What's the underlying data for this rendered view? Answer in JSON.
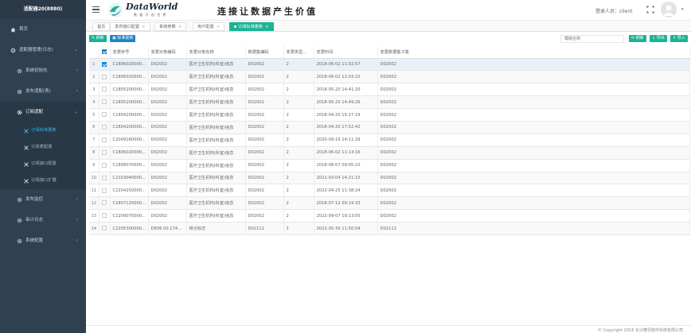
{
  "sidebar": {
    "title": "适配器20(8880)",
    "items": [
      {
        "label": "首页",
        "icon": "home-icon"
      },
      {
        "label": "适配器管理(日志)",
        "icon": "settings-icon",
        "expandable": true
      },
      {
        "label": "系统初始化",
        "icon": "gear-icon",
        "expandable": true
      },
      {
        "label": "发布适配(表)",
        "icon": "gear-icon",
        "expandable": true
      },
      {
        "label": "订阅适配",
        "icon": "gear-icon",
        "expandable": true
      },
      {
        "label": "发布监控",
        "icon": "gear-icon",
        "expandable": true
      },
      {
        "label": "审计日志",
        "icon": "gear-icon",
        "expandable": true
      },
      {
        "label": "系统配置",
        "icon": "gear-icon",
        "expandable": true
      }
    ],
    "subitems": [
      {
        "label": "订阅标准更新",
        "selected": true
      },
      {
        "label": "订阅表配置"
      },
      {
        "label": "订阅接口配置"
      },
      {
        "label": "订阅接口扩展"
      }
    ]
  },
  "header": {
    "brand": "DataWorld",
    "brand_sub": "数 据 开 创 世 界",
    "slogan": "连接让数据产生价值",
    "user_label": "登录人员：client"
  },
  "tabs": [
    {
      "label": "首页",
      "closable": false
    },
    {
      "label": "发布接口配置",
      "closable": true
    },
    {
      "label": "系统参数",
      "closable": true
    },
    {
      "label": "用户配置",
      "closable": true
    },
    {
      "label": "订阅标准更新",
      "closable": true,
      "active": true
    }
  ],
  "toolbar": {
    "left_buttons": [
      "刷新",
      "标准更新"
    ],
    "search_placeholder": "模版名称",
    "right_buttons": [
      "刷新",
      "导出",
      "导入"
    ]
  },
  "table": {
    "columns": [
      "",
      "",
      "变更序号",
      "变更对象编码",
      "变更对象名称",
      "数据集编码",
      "变更类型...",
      "变更时间",
      "变更数据集子集"
    ],
    "rows": [
      {
        "n": "1",
        "checked": true,
        "c1": "C1806020000...",
        "c2": "D02002",
        "c3": "医疗卫生机构(科室)信息",
        "c4": "D02002",
        "c5": "2",
        "c6": "2018-06-02 11:02:57",
        "c7": "D02002"
      },
      {
        "n": "2",
        "checked": false,
        "c1": "C1806020000...",
        "c2": "D02002",
        "c3": "医疗卫生机构(科室)信息",
        "c4": "D02002",
        "c5": "2",
        "c6": "2018-06-02 11:03:22",
        "c7": "D02002"
      },
      {
        "n": "3",
        "checked": false,
        "c1": "C1805200000...",
        "c2": "D02002",
        "c3": "医疗卫生机构(科室)信息",
        "c4": "D02002",
        "c5": "2",
        "c6": "2018-05-20 14:41:20",
        "c7": "D02002"
      },
      {
        "n": "4",
        "checked": false,
        "c1": "C1805200000...",
        "c2": "D02002",
        "c3": "医疗卫生机构(科室)信息",
        "c4": "D02002",
        "c5": "2",
        "c6": "2018-05-20 14:49:26",
        "c7": "D02002"
      },
      {
        "n": "5",
        "checked": false,
        "c1": "C1804200000...",
        "c2": "D02002",
        "c3": "医疗卫生机构(科室)信息",
        "c4": "D02002",
        "c5": "2",
        "c6": "2018-04-20 15:27:19",
        "c7": "D02002"
      },
      {
        "n": "6",
        "checked": false,
        "c1": "C1804200000...",
        "c2": "D02002",
        "c3": "医疗卫生机构(科室)信息",
        "c4": "D02002",
        "c5": "2",
        "c6": "2018-04-20 17:52:42",
        "c7": "D02002"
      },
      {
        "n": "7",
        "checked": false,
        "c1": "C2009160000...",
        "c2": "D02002",
        "c3": "医疗卫生机构(科室)信息",
        "c4": "D02002",
        "c5": "2",
        "c6": "2020-09-16 14:11:29",
        "c7": "D02002"
      },
      {
        "n": "8",
        "checked": false,
        "c1": "C1806020000...",
        "c2": "D02002",
        "c3": "医疗卫生机构(科室)信息",
        "c4": "D02002",
        "c5": "2",
        "c6": "2018-06-02 11:14:16",
        "c7": "D02002"
      },
      {
        "n": "9",
        "checked": false,
        "c1": "C1808070000...",
        "c2": "D02002",
        "c3": "医疗卫生机构(科室)信息",
        "c4": "D02002",
        "c5": "2",
        "c6": "2018-08-07 09:05:10",
        "c7": "D02002"
      },
      {
        "n": "10",
        "checked": false,
        "c1": "C2103040000...",
        "c2": "D02002",
        "c3": "医疗卫生机构(科室)信息",
        "c4": "D02002",
        "c5": "2",
        "c6": "2021-03-04 14:21:15",
        "c7": "D02002"
      },
      {
        "n": "11",
        "checked": false,
        "c1": "C2204250000...",
        "c2": "D02002",
        "c3": "医疗卫生机构(科室)信息",
        "c4": "D02002",
        "c5": "2",
        "c6": "2022-04-25 11:38:24",
        "c7": "D02002"
      },
      {
        "n": "12",
        "checked": false,
        "c1": "C1807120000...",
        "c2": "D02002",
        "c3": "医疗卫生机构(科室)信息",
        "c4": "D02002",
        "c5": "2",
        "c6": "2018-07-12 09:19:33",
        "c7": "D02002"
      },
      {
        "n": "13",
        "checked": false,
        "c1": "C2209070000...",
        "c2": "D02002",
        "c3": "医疗卫生机构(科室)信息",
        "c4": "D02002",
        "c5": "2",
        "c6": "2022-09-07 19:13:05",
        "c7": "D02002"
      },
      {
        "n": "14",
        "checked": false,
        "c1": "C2205300000...",
        "c2": "DE06.00.174...",
        "c3": "转诊标志",
        "c4": "D02112",
        "c5": "1",
        "c6": "2022-05-30 11:50:54",
        "c7": "D02112"
      }
    ]
  },
  "footer": {
    "copyright": "© Copyright 2016 长沙攀讯软件科技有限公司"
  },
  "colors": {
    "sidebar_bg": "#2f4050",
    "accent_green": "#1ab394",
    "accent_blue": "#1c84c6"
  }
}
